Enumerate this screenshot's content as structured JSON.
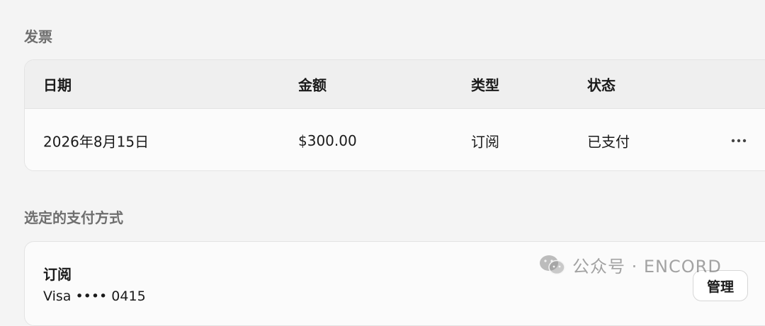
{
  "invoices": {
    "title": "发票",
    "columns": [
      "日期",
      "金额",
      "类型",
      "状态"
    ],
    "rows": [
      {
        "date": "2026年8月15日",
        "amount": "$300.00",
        "type": "订阅",
        "status": "已支付",
        "more_icon": "more-horizontal-icon"
      }
    ]
  },
  "payment": {
    "title": "选定的支付方式",
    "method_name": "订阅",
    "method_detail": "Visa •••• 0415",
    "manage_label": "管理"
  },
  "watermark": {
    "text": "公众号 · ENCORD",
    "icon": "wechat-icon"
  },
  "colors": {
    "background": "#f4f4f4",
    "header_bg": "#efefef",
    "section_title": "#6e6e6e"
  }
}
